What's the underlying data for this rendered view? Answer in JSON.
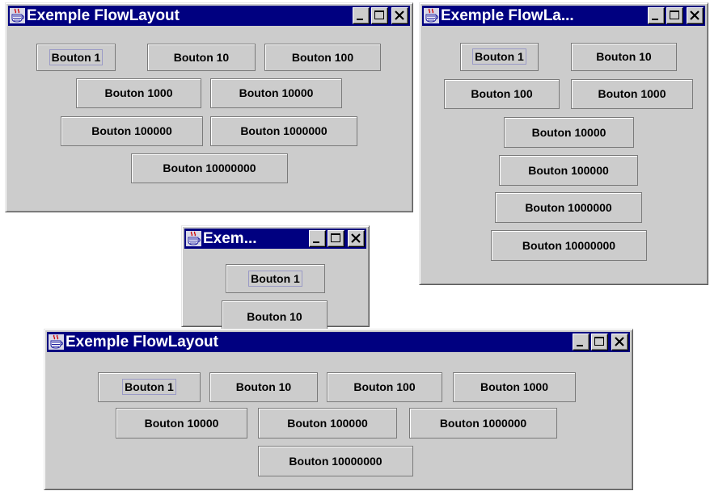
{
  "colors": {
    "titlebar": "#000080",
    "window": "#cccccc",
    "focus": "#9a9ac6"
  },
  "icons": {
    "app": "java-coffee-cup-icon",
    "minimize": "minimize-icon",
    "maximize": "maximize-icon",
    "close": "close-icon"
  },
  "windows": [
    {
      "title": "Exemple FlowLayout",
      "buttons": [
        "Bouton 1",
        "Bouton 10",
        "Bouton 100",
        "Bouton 1000",
        "Bouton 10000",
        "Bouton 100000",
        "Bouton 1000000",
        "Bouton 10000000"
      ]
    },
    {
      "title": "Exemple FlowLa...",
      "buttons": [
        "Bouton 1",
        "Bouton 10",
        "Bouton 100",
        "Bouton 1000",
        "Bouton 10000",
        "Bouton 100000",
        "Bouton 1000000",
        "Bouton 10000000"
      ]
    },
    {
      "title": "Exem...",
      "buttons": [
        "Bouton 1",
        "Bouton 10"
      ]
    },
    {
      "title": "Exemple FlowLayout",
      "buttons": [
        "Bouton 1",
        "Bouton 10",
        "Bouton 100",
        "Bouton 1000",
        "Bouton 10000",
        "Bouton 100000",
        "Bouton 1000000",
        "Bouton 10000000"
      ]
    }
  ]
}
